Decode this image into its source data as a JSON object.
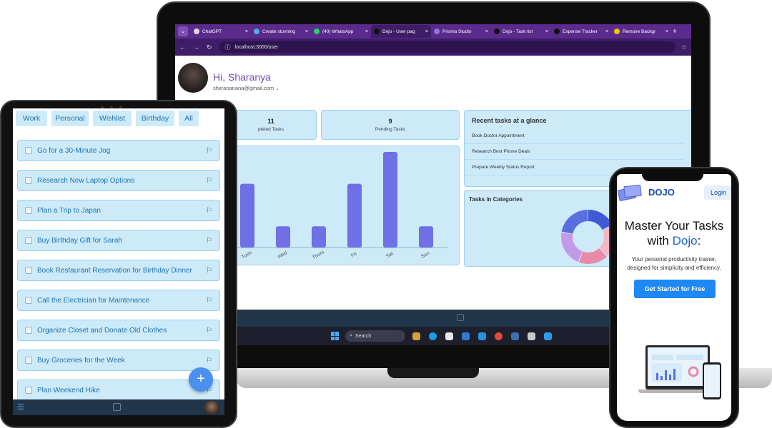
{
  "browser": {
    "tabs": [
      {
        "label": "ChatGPT",
        "favicon": "#d9d9d9",
        "active": false
      },
      {
        "label": "Create stunning",
        "favicon": "#4ab0e8",
        "active": false
      },
      {
        "label": "(40) WhatsApp",
        "favicon": "#25d366",
        "active": false
      },
      {
        "label": "Dojo - User pag",
        "favicon": "#111111",
        "active": true
      },
      {
        "label": "Prisma Studio",
        "favicon": "#8a7bd8",
        "active": false
      },
      {
        "label": "Dojo - Task list",
        "favicon": "#111111",
        "active": false
      },
      {
        "label": "Expense Tracker",
        "favicon": "#111111",
        "active": false
      },
      {
        "label": "Remove Backgr",
        "favicon": "#f2c200",
        "active": false
      }
    ],
    "new_tab_label": "+",
    "close_glyph": "×",
    "url": "localhost:3000/user"
  },
  "laptop_app": {
    "greeting": "Hi, Sharanya",
    "email": "shxrananana@gmail.com",
    "completed": {
      "value": "11",
      "label": "pleted Tasks"
    },
    "pending": {
      "value": "9",
      "label": "Pending Tasks"
    },
    "recent_title": "Recent tasks at a glance",
    "recent_tasks": [
      "Book Doctor Appointment",
      "Research Best Phone Deals",
      "Prepare Weekly Status Report"
    ],
    "categories_title": "Tasks in Categories"
  },
  "chart_data": {
    "type": "bar",
    "categories": [
      "Tues",
      "Wed",
      "Thurs",
      "Fri",
      "Sat",
      "Sun"
    ],
    "values": [
      6,
      2,
      2,
      6,
      9,
      2
    ],
    "ylim": [
      0,
      9
    ],
    "bar_color": "#6f6fe6"
  },
  "donut_data": {
    "type": "pie",
    "slices": [
      {
        "value": 18,
        "color": "#3f5ad4"
      },
      {
        "value": 20,
        "color": "#f5b7c2"
      },
      {
        "value": 18,
        "color": "#e88aa8"
      },
      {
        "value": 22,
        "color": "#c39ae8"
      },
      {
        "value": 22,
        "color": "#5a6ee0"
      }
    ]
  },
  "taskbar": {
    "search_label": "Search"
  },
  "tablet": {
    "chips": [
      "Work",
      "Personal",
      "Wishlist",
      "Birthday",
      "All"
    ],
    "tasks": [
      "Go for a 30-Minute Jog",
      "Research New Laptop Options",
      "Plan a Trip to Japan",
      "Buy Birthday Gift for Sarah",
      "Book Restaurant Reservation for Birthday Dinner",
      "Call the Electrician for Maintenance",
      "Organize Closet and Donate Old Clothes",
      "Buy Groceries for the Week",
      "Plan Weekend Hike"
    ],
    "fab_label": "+"
  },
  "phone": {
    "brand": "DOJO",
    "login_label": "Login",
    "headline_part1": "Master Your Tasks",
    "headline_part2": "with ",
    "headline_brand": "Dojo",
    "headline_colon": ":",
    "subtitle_line1": "Your personal productivity trainer,",
    "subtitle_line2": "designed for simplicity and efficiency.",
    "cta_label": "Get Started for Free"
  }
}
